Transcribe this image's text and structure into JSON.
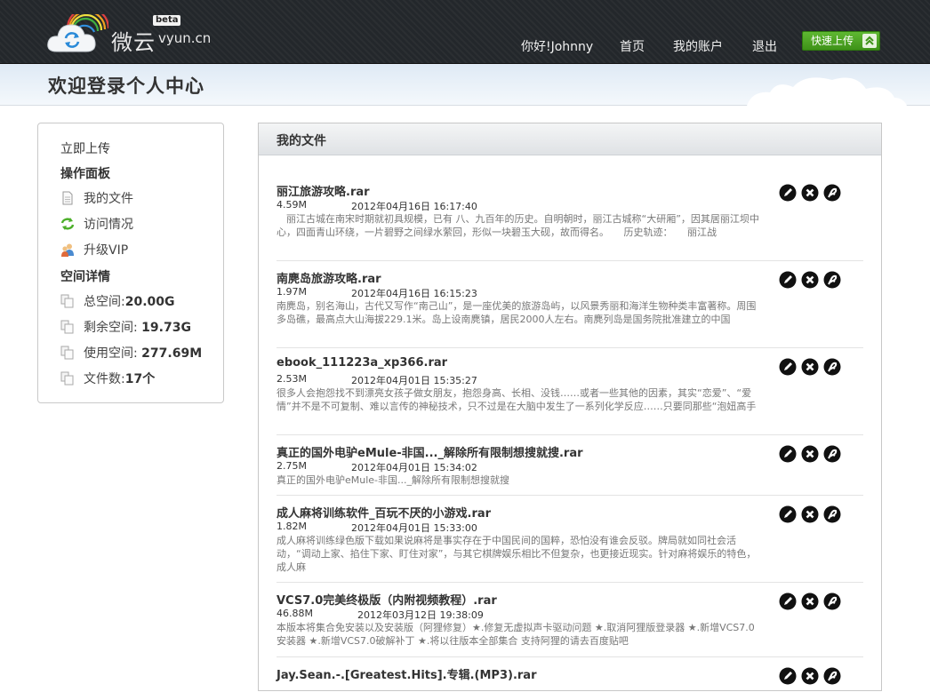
{
  "header": {
    "brand_cn": "微云",
    "brand_en": "vyun.cn",
    "beta": "beta",
    "nav": [
      {
        "id": "greeting",
        "label": "你好!Johnny"
      },
      {
        "id": "home",
        "label": "首页"
      },
      {
        "id": "account",
        "label": "我的账户"
      },
      {
        "id": "logout",
        "label": "退出"
      }
    ],
    "quick_upload": "快速上传",
    "colors": {
      "bar": "#23272b",
      "upload": "#4ea524"
    }
  },
  "subheader": {
    "title": "欢迎登录个人中心"
  },
  "sidebar": {
    "upload_now": "立即上传",
    "panel_heading": "操作面板",
    "panel_items": [
      {
        "icon": "document-icon",
        "label": "我的文件"
      },
      {
        "icon": "refresh-arrows-icon",
        "label": "访问情况"
      },
      {
        "icon": "users-icon",
        "label": "升级VIP"
      }
    ],
    "space_heading": "空间详情",
    "space_items": [
      {
        "icon": "copy-icon",
        "label": "总空间:",
        "value": "20.00G"
      },
      {
        "icon": "copy-icon",
        "label": "剩余空间: ",
        "value": "19.73G"
      },
      {
        "icon": "copy-icon",
        "label": "使用空间: ",
        "value": "277.69M"
      },
      {
        "icon": "copy-icon",
        "label": "文件数:",
        "value": "17个"
      }
    ]
  },
  "main": {
    "title": "我的文件",
    "files": [
      {
        "name": "丽江旅游攻略.rar",
        "size": "4.59M",
        "date": "2012年04月16日 16:17:40",
        "desc": "　丽江古城在南宋时期就初具规模，已有 八、九百年的历史。自明朝时，丽江古城称“大研厢”，因其居丽江坝中心，四面青山环绕，一片碧野之间绿水萦回，形似一块碧玉大砚，故而得名。　　历史轨迹：　　丽江战"
      },
      {
        "name": "南麂岛旅游攻略.rar",
        "size": "1.97M",
        "date": "2012年04月16日 16:15:23",
        "desc": "南麂岛，别名海山，古代又写作“南己山”，是一座优美的旅游岛屿，以风景秀丽和海洋生物种类丰富著称。周围多岛礁，最高点大山海拔229.1米。岛上设南麂镇，居民2000人左右。南麂列岛是国务院批准建立的中国"
      },
      {
        "name": "ebook_111223a_xp366.rar",
        "size": "2.53M",
        "date": "2012年04月01日 15:35:27",
        "desc": "很多人会抱怨找不到漂亮女孩子做女朋友，抱怨身高、长相、没钱……或者一些其他的因素，其实“恋爱”、“爱情”并不是不可复制、难以言传的神秘技术，只不过是在大脑中发生了一系列化学反应……只要同那些“泡妞高手"
      },
      {
        "name": "真正的国外电驴eMule-非国..._解除所有限制想搜就搜.rar",
        "size": "2.75M",
        "date": "2012年04月01日 15:34:02",
        "desc": "真正的国外电驴eMule-非国..._解除所有限制想搜就搜"
      },
      {
        "name": "成人麻将训练软件_百玩不厌的小游戏.rar",
        "size": "1.82M",
        "date": "2012年04月01日 15:33:00",
        "desc": "成人麻将训练绿色版下载如果说麻将是事实存在于中国民间的国粹，恐怕没有谁会反驳。牌局就如同社会活动，“调动上家、掐住下家、盯住对家”，与其它棋牌娱乐相比不但复杂，也更接近现实。针对麻将娱乐的特色，成人麻"
      },
      {
        "name": "VCS7.0完美终极版（内附视频教程）.rar",
        "size": "46.88M",
        "date": "2012年03月12日 19:38:09",
        "desc": "本版本将集合免安装以及安装版（阿狸修复）★.修复无虚拟声卡驱动问题 ★.取消阿狸版登录器 ★.新增VCS7.0安装器 ★.新增VCS7.0破解补丁 ★.将以往版本全部集合 支持阿狸的请去百度贴吧"
      },
      {
        "name": "Jay.Sean.-.[Greatest.Hits].专辑.(MP3).rar",
        "size": "",
        "date": "",
        "desc": ""
      }
    ]
  }
}
